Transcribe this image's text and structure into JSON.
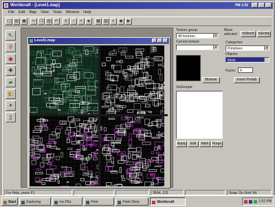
{
  "window": {
    "title": "Worldcraft - [Level1.map]",
    "corner_text": "PM 1:52"
  },
  "menu": [
    "File",
    "Edit",
    "Map",
    "View",
    "Tools",
    "Window",
    "Help"
  ],
  "toolbar": {
    "buttons": [
      {
        "name": "new-icon",
        "glyph": "▢"
      },
      {
        "name": "open-icon",
        "glyph": "▤"
      },
      {
        "name": "save-icon",
        "glyph": "▣"
      },
      {
        "name": "cut-icon",
        "glyph": "✂"
      },
      {
        "name": "copy-icon",
        "glyph": "❐"
      },
      {
        "name": "paste-icon",
        "glyph": "▥"
      },
      {
        "name": "undo-icon",
        "glyph": "↶"
      },
      {
        "name": "grid-icon",
        "glyph": "#"
      },
      {
        "name": "grid-smaller-icon",
        "glyph": "−"
      },
      {
        "name": "grid-larger-icon",
        "glyph": "+"
      },
      {
        "name": "texture-lock-icon",
        "glyph": "◈"
      },
      {
        "name": "group-icon",
        "glyph": "▦"
      },
      {
        "name": "ungroup-icon",
        "glyph": "▧"
      },
      {
        "name": "hide-icon",
        "glyph": "◐"
      },
      {
        "name": "carve-icon",
        "glyph": "◆"
      },
      {
        "name": "run-map-icon",
        "glyph": "▶"
      }
    ]
  },
  "tools": [
    {
      "name": "selection-tool-icon",
      "glyph": "↖",
      "color": "#222222"
    },
    {
      "name": "magnify-tool-icon",
      "glyph": "⚲",
      "color": "#b02020"
    },
    {
      "name": "camera-tool-icon",
      "glyph": "◉",
      "color": "#b02020"
    },
    {
      "name": "entity-tool-icon",
      "glyph": "✚",
      "color": "#333333"
    },
    {
      "name": "block-tool-icon",
      "glyph": "▰",
      "color": "#2a7a2a"
    },
    {
      "name": "texture-tool-icon",
      "glyph": "◧",
      "color": "#c08020"
    },
    {
      "name": "decal-tool-icon",
      "glyph": "✦",
      "color": "#b02020"
    },
    {
      "name": "clip-tool-icon",
      "glyph": "▯",
      "color": "#333333"
    }
  ],
  "map_window": {
    "title": "Level1.map"
  },
  "right_panel": {
    "texture_group_label": "Texture group:",
    "texture_group_value": "All textures",
    "current_texture_label": "Current texture:",
    "current_texture_value": "",
    "browse_label": "Browse",
    "move_selected_label": "Move selected",
    "to_world_label": "toWorld",
    "to_entity_label": "toEntity",
    "categories_label": "Categories:",
    "categories_value": "Primitives",
    "objects_label": "Objects:",
    "objects_value": "block",
    "faces_label": "Faces:",
    "faces_value": "4",
    "insert_prefab_label": "Insert Prefab",
    "visgroups_label": "VisGroups:",
    "vis_buttons": [
      "Apply",
      "Edit",
      "Mark",
      "Purge"
    ]
  },
  "status": {
    "cells": [
      "For Help, press F1",
      "",
      "",
      "3664, 132",
      ""
    ],
    "snap": "Snap: On Grid: 64"
  },
  "taskbar": {
    "start": "Start",
    "items": [
      "Exploring",
      "mc.PSs",
      "Print",
      "Paint Shop",
      "Worldcraft"
    ],
    "active_index": 4,
    "clock": "1:52 PM"
  },
  "colors": {
    "titlebar": "#2e2f8e",
    "face": "#c6c3bc",
    "viewport_bg": "#050505",
    "grid_green": "#2f7a4e",
    "brush_white": "#ffffff",
    "brush_magenta": "#c23bd0"
  }
}
